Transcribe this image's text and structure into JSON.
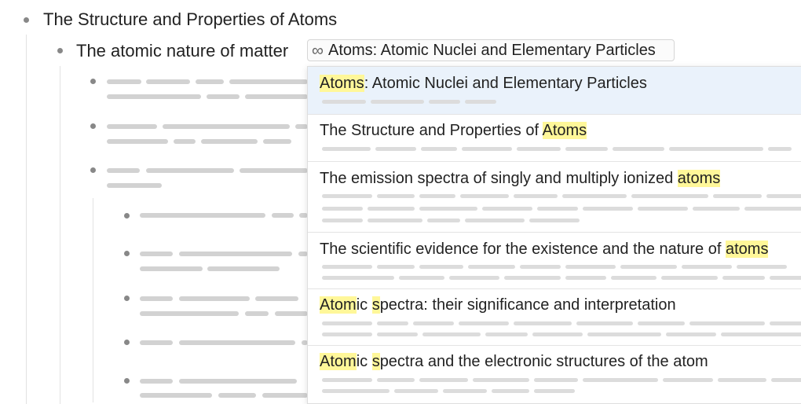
{
  "outline": {
    "root": {
      "text": "The Structure and Properties of Atoms"
    },
    "child": {
      "text": "The atomic nature of matter",
      "link_chip": {
        "icon": "infinity-link-icon",
        "label": "Atoms: Atomic Nuclei and Elementary Particles"
      }
    }
  },
  "popup": {
    "results": [
      {
        "segments": [
          {
            "text": "Atoms",
            "hl": true
          },
          {
            "text": ": Atomic Nuclei and Elementary Particles",
            "hl": false
          }
        ],
        "selected": true
      },
      {
        "segments": [
          {
            "text": "The Structure and Properties of ",
            "hl": false
          },
          {
            "text": "Atoms",
            "hl": true
          }
        ],
        "selected": false
      },
      {
        "segments": [
          {
            "text": "The emission spectra of singly and multiply ionized ",
            "hl": false
          },
          {
            "text": "atoms",
            "hl": true
          }
        ],
        "selected": false
      },
      {
        "segments": [
          {
            "text": "The scientific evidence for the existence and the nature of ",
            "hl": false
          },
          {
            "text": "atoms",
            "hl": true
          }
        ],
        "selected": false
      },
      {
        "segments": [
          {
            "text": "Atom",
            "hl": true
          },
          {
            "text": "ic ",
            "hl": false
          },
          {
            "text": "s",
            "hl": true
          },
          {
            "text": "pectra: their significance and interpretation",
            "hl": false
          }
        ],
        "selected": false
      },
      {
        "segments": [
          {
            "text": "Atom",
            "hl": true
          },
          {
            "text": "ic ",
            "hl": false
          },
          {
            "text": "s",
            "hl": true
          },
          {
            "text": "pectra and the electronic structures of the atom",
            "hl": false
          }
        ],
        "selected": false
      }
    ]
  },
  "colors": {
    "highlight": "#fff799",
    "selected_row": "#eaf2fb",
    "placeholder": "#d2d2d2"
  }
}
